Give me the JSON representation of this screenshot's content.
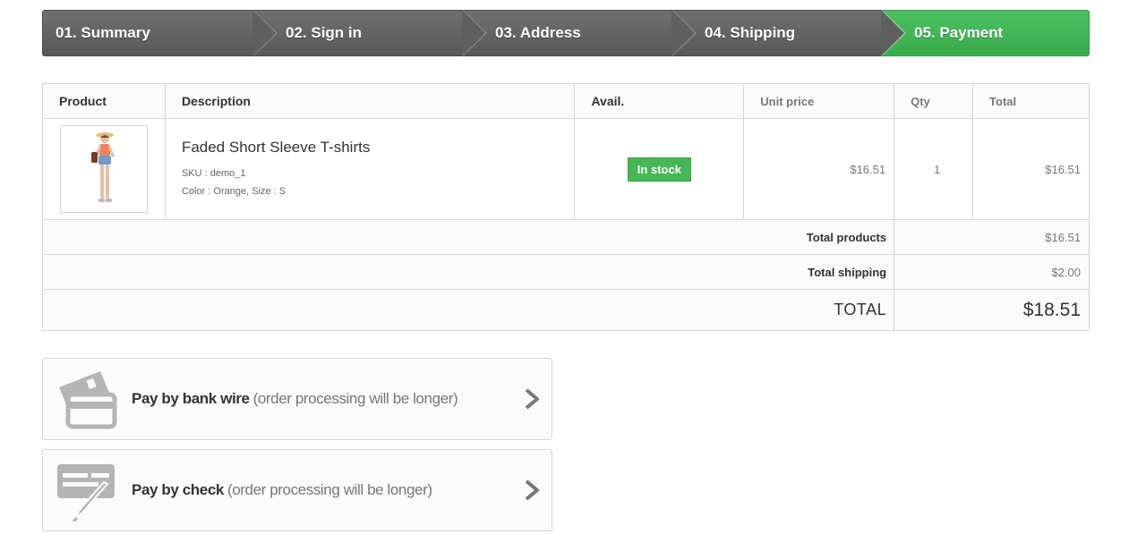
{
  "steps": [
    {
      "label": "01. Summary"
    },
    {
      "label": "02. Sign in"
    },
    {
      "label": "03. Address"
    },
    {
      "label": "04. Shipping"
    },
    {
      "label": "05. Payment",
      "active": true
    }
  ],
  "cart": {
    "headers": [
      "Product",
      "Description",
      "Avail.",
      "Unit price",
      "Qty",
      "Total"
    ],
    "rows": [
      {
        "image_icon": "product-thumbnail",
        "name": "Faded Short Sleeve T-shirts",
        "sku": "SKU : demo_1",
        "attributes": "Color : Orange, Size : S",
        "availability": "In stock",
        "unit_price": "$16.51",
        "qty": "1",
        "total": "$16.51"
      }
    ],
    "totals": {
      "products_label": "Total products",
      "products_value": "$16.51",
      "shipping_label": "Total shipping",
      "shipping_value": "$2.00",
      "grand_label": "TOTAL",
      "grand_value": "$18.51"
    }
  },
  "payment_options": [
    {
      "icon": "bank-card-icon",
      "title": "Pay by bank wire",
      "note": "(order processing will be longer)"
    },
    {
      "icon": "check-pen-icon",
      "title": "Pay by check",
      "note": "(order processing will be longer)"
    }
  ],
  "colors": {
    "step_inactive": "#5f5f5f",
    "step_active": "#46b754",
    "in_stock": "#46b754",
    "border": "#d6d4d4",
    "icon_gray": "#b5b5b5"
  }
}
